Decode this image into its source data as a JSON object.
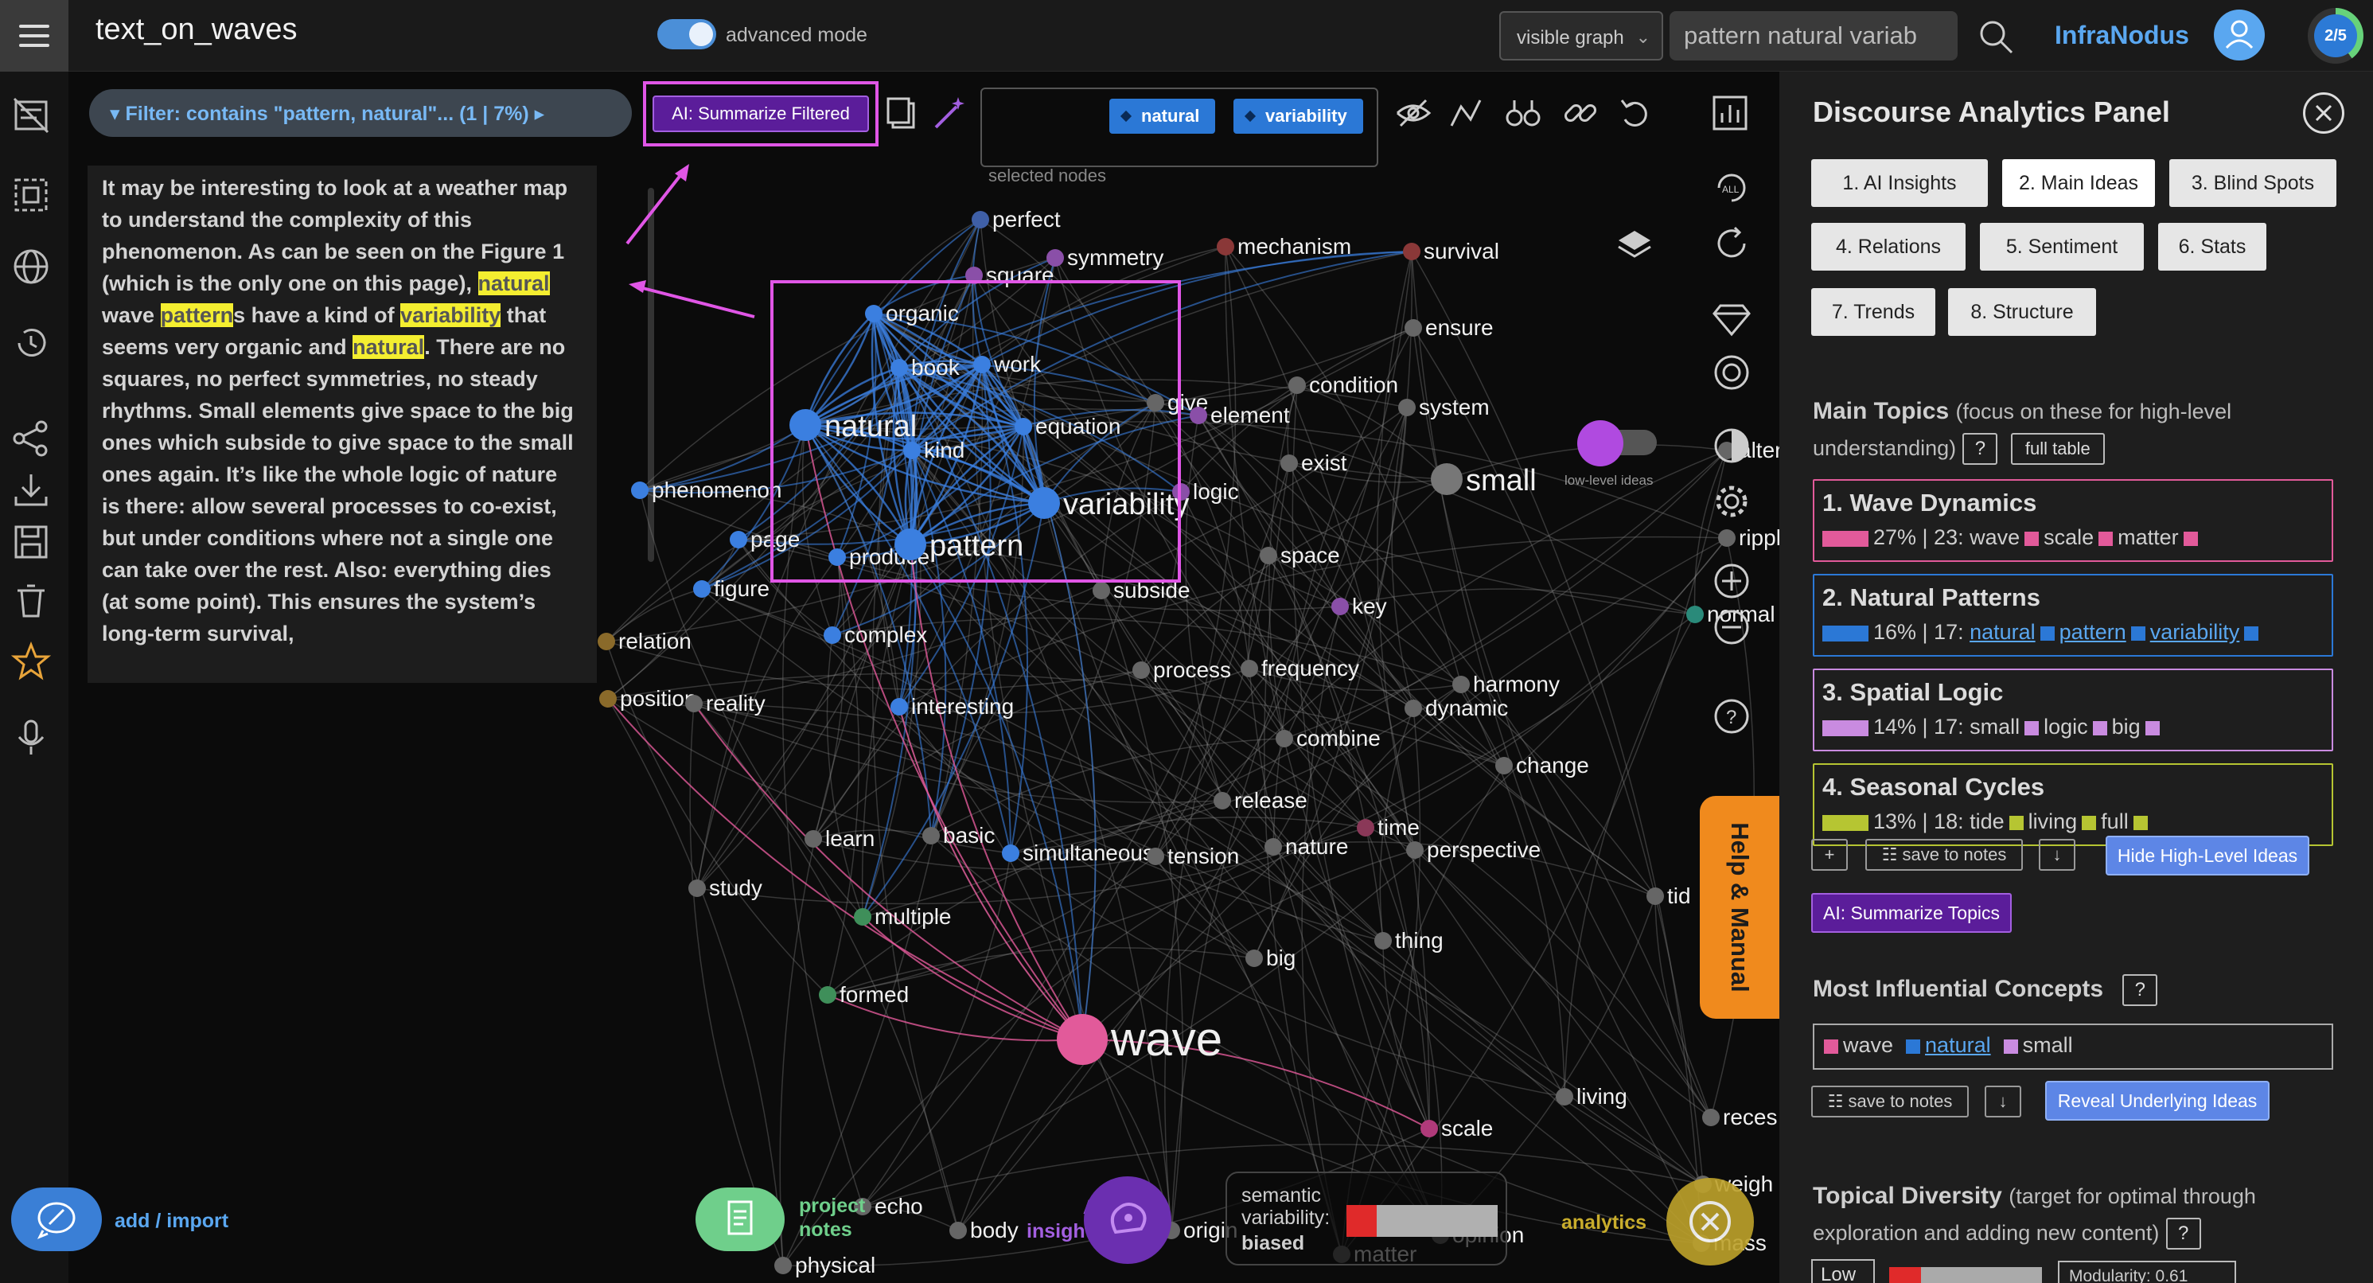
{
  "app": {
    "title": "text_on_waves",
    "advanced_mode_label": "advanced mode",
    "visible_graph_select": "visible graph",
    "search_value": "pattern natural variab",
    "brand": "InfraNodus",
    "progress_badge": "2/5"
  },
  "filter": {
    "label": "Filter: contains \"pattern, natural\"... (1 | 7%)"
  },
  "text_panel": {
    "segments": [
      {
        "t": "It may be interesting to look at a weather map to understand the complexity of this phenomenon. As can be seen on the Figure 1 (which is the only one on this page), "
      },
      {
        "t": "natural",
        "hl": true
      },
      {
        "t": " wave "
      },
      {
        "t": "pattern",
        "hl": true
      },
      {
        "t": "s have a kind of "
      },
      {
        "t": "variability",
        "hl": true
      },
      {
        "t": " that seems very organic and "
      },
      {
        "t": "natural",
        "hl": true
      },
      {
        "t": ". There are no squares, no perfect symmetries, no steady rhythms. Small elements give space to the big ones which subside to give space to the small ones again. It’s like the whole logic of nature is there: allow several processes to co-exist, but under conditions where not a single one can take over the rest. Also: everything dies (at some point). This ensures the system’s long-term survival,"
      }
    ],
    "add_import_label": "add / import"
  },
  "summarize_filtered": "AI: Summarize Filtered",
  "selected_nodes": {
    "chips": [
      "natural",
      "variability"
    ],
    "label": "selected nodes"
  },
  "graph": {
    "low_level_ideas_label": "low-level ideas",
    "nodes": [
      {
        "label": "perfect",
        "color": "#3f5fa6",
        "big": false
      },
      {
        "label": "symmetry",
        "color": "#8a4fa8",
        "big": false
      },
      {
        "label": "square",
        "color": "#8a4fa8",
        "big": false
      },
      {
        "label": "mechanism",
        "color": "#8a3838",
        "big": false
      },
      {
        "label": "survival",
        "color": "#8a3838",
        "big": false
      },
      {
        "label": "organic",
        "color": "#3b7fe0",
        "big": false
      },
      {
        "label": "book",
        "color": "#3b7fe0",
        "big": false
      },
      {
        "label": "work",
        "color": "#3b7fe0",
        "big": false
      },
      {
        "label": "ensure",
        "color": "#666",
        "big": false
      },
      {
        "label": "condition",
        "color": "#666",
        "big": false
      },
      {
        "label": "natural",
        "color": "#3b7fe0",
        "big": true
      },
      {
        "label": "give",
        "color": "#666",
        "big": false
      },
      {
        "label": "element",
        "color": "#8a4fa8",
        "big": false
      },
      {
        "label": "system",
        "color": "#666",
        "big": false
      },
      {
        "label": "equation",
        "color": "#3b7fe0",
        "big": false
      },
      {
        "label": "kind",
        "color": "#3b7fe0",
        "big": false
      },
      {
        "label": "exist",
        "color": "#666",
        "big": false
      },
      {
        "label": "small",
        "color": "#777",
        "big": true
      },
      {
        "label": "phenomenon",
        "color": "#3b7fe0",
        "big": false
      },
      {
        "label": "logic",
        "color": "#8a4fa8",
        "big": false
      },
      {
        "label": "variability",
        "color": "#3b7fe0",
        "big": true
      },
      {
        "label": "page",
        "color": "#3b7fe0",
        "big": false
      },
      {
        "label": "produce",
        "color": "#3b7fe0",
        "big": false
      },
      {
        "label": "pattern",
        "color": "#3b7fe0",
        "big": true
      },
      {
        "label": "space",
        "color": "#666",
        "big": false
      },
      {
        "label": "figure",
        "color": "#3b7fe0",
        "big": false
      },
      {
        "label": "subside",
        "color": "#666",
        "big": false
      },
      {
        "label": "key",
        "color": "#8a4fa8",
        "big": false
      },
      {
        "label": "relation",
        "color": "#8a6a2a",
        "big": false
      },
      {
        "label": "complex",
        "color": "#3b7fe0",
        "big": false
      },
      {
        "label": "process",
        "color": "#666",
        "big": false
      },
      {
        "label": "frequency",
        "color": "#666",
        "big": false
      },
      {
        "label": "harmony",
        "color": "#666",
        "big": false
      },
      {
        "label": "position",
        "color": "#8a6a2a",
        "big": false
      },
      {
        "label": "reality",
        "color": "#666",
        "big": false
      },
      {
        "label": "interesting",
        "color": "#3b7fe0",
        "big": false
      },
      {
        "label": "dynamic",
        "color": "#666",
        "big": false
      },
      {
        "label": "combine",
        "color": "#666",
        "big": false
      },
      {
        "label": "change",
        "color": "#666",
        "big": false
      },
      {
        "label": "release",
        "color": "#666",
        "big": false
      },
      {
        "label": "learn",
        "color": "#666",
        "big": false
      },
      {
        "label": "basic",
        "color": "#666",
        "big": false
      },
      {
        "label": "simultaneous",
        "color": "#3b7fe0",
        "big": false
      },
      {
        "label": "tension",
        "color": "#666",
        "big": false
      },
      {
        "label": "time",
        "color": "#8a3858",
        "big": false
      },
      {
        "label": "nature",
        "color": "#666",
        "big": false
      },
      {
        "label": "perspective",
        "color": "#666",
        "big": false
      },
      {
        "label": "study",
        "color": "#666",
        "big": false
      },
      {
        "label": "multiple",
        "color": "#3f8f5a",
        "big": false
      },
      {
        "label": "thing",
        "color": "#666",
        "big": false
      },
      {
        "label": "big",
        "color": "#666",
        "big": false
      },
      {
        "label": "formed",
        "color": "#3f8f5a",
        "big": false
      },
      {
        "label": "wave",
        "color": "#e25a9a",
        "big": true
      },
      {
        "label": "living",
        "color": "#666",
        "big": false
      },
      {
        "label": "scale",
        "color": "#b03a7a",
        "big": false
      },
      {
        "label": "echo",
        "color": "#666",
        "big": false
      },
      {
        "label": "body",
        "color": "#666",
        "big": false
      },
      {
        "label": "origin",
        "color": "#666",
        "big": false
      },
      {
        "label": "opinion",
        "color": "#666",
        "big": false
      },
      {
        "label": "matter",
        "color": "#666",
        "big": false
      },
      {
        "label": "physical",
        "color": "#666",
        "big": false
      },
      {
        "label": "mass",
        "color": "#666",
        "big": false
      },
      {
        "label": "altern",
        "color": "#666",
        "big": false
      },
      {
        "label": "rippl",
        "color": "#666",
        "big": false
      },
      {
        "label": "normal",
        "color": "#2a8a7a",
        "big": false
      },
      {
        "label": "tid",
        "color": "#666",
        "big": false
      },
      {
        "label": "reces",
        "color": "#666",
        "big": false
      },
      {
        "label": "weigh",
        "color": "#666",
        "big": false
      }
    ]
  },
  "help_tab": "Help & Manual",
  "bottom": {
    "project_notes": [
      "project",
      "notes"
    ],
    "ai_insights": [
      "AI",
      "insights"
    ],
    "bias": {
      "line1": "semantic",
      "line2": "variability:",
      "line3": "biased",
      "red_fraction": 0.2
    },
    "analytics": "analytics"
  },
  "panel": {
    "title": "Discourse Analytics Panel",
    "tabs": [
      "1. AI Insights",
      "2. Main Ideas",
      "3. Blind Spots",
      "4. Relations",
      "5. Sentiment",
      "6. Stats",
      "7. Trends",
      "8. Structure"
    ],
    "main_topics_title": "Main Topics",
    "main_topics_sub": "(focus on these for high-level understanding)",
    "help_q": "?",
    "full_table": "full table",
    "topics": [
      {
        "title": "1. Wave Dynamics",
        "pct": "27% | 23:",
        "color": "#e25a9a",
        "words": [
          "wave",
          "scale",
          "matter"
        ],
        "links": false
      },
      {
        "title": "2. Natural Patterns",
        "pct": "16% | 17:",
        "color": "#2b78d6",
        "words": [
          "natural",
          "pattern",
          "variability"
        ],
        "links": true
      },
      {
        "title": "3. Spatial Logic",
        "pct": "14% | 17:",
        "color": "#c98be0",
        "words": [
          "small",
          "logic",
          "big"
        ],
        "links": false
      },
      {
        "title": "4. Seasonal Cycles",
        "pct": "13% | 18:",
        "color": "#b6c532",
        "words": [
          "tide",
          "living",
          "full"
        ],
        "links": false
      }
    ],
    "plus": "+",
    "save_to_notes": "save to notes",
    "download": "↓",
    "hide_high_level": "Hide High-Level Ideas",
    "ai_summarize_topics": "AI: Summarize Topics",
    "influential_title": "Most Influential Concepts",
    "influential": [
      {
        "word": "wave",
        "color": "#e25a9a",
        "link": false
      },
      {
        "word": "natural",
        "color": "#2b78d6",
        "link": true
      },
      {
        "word": "small",
        "color": "#c98be0",
        "link": false
      }
    ],
    "reveal_underlying": "Reveal Underlying Ideas",
    "diversity_title": "Topical Diversity",
    "diversity_sub": "(target for optimal through exploration and adding new content)",
    "diversity_level": "Low",
    "modularity": "Modularity: 0.61"
  },
  "colors": {
    "accent_blue": "#5aa7f0",
    "highlight": "#f4ee30",
    "annotation_magenta": "#e056e6",
    "help_orange": "#f08a1d"
  }
}
